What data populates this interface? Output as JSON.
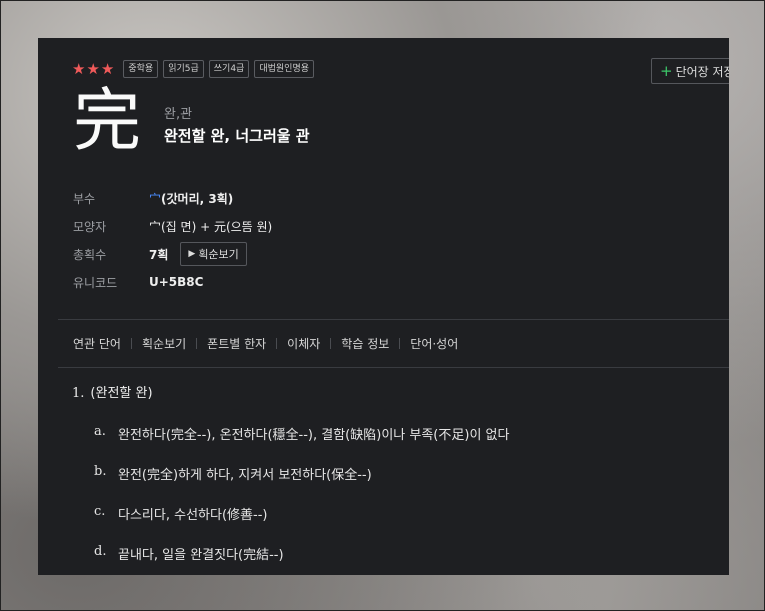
{
  "entry": {
    "stars": "★★★",
    "badges": [
      "중학용",
      "읽기5급",
      "쓰기4급",
      "대법원인명용"
    ],
    "save_button": "단어장 저장",
    "character": "完",
    "reading": "완,관",
    "meaning": "완전할 완, 너그러울 관"
  },
  "info": {
    "radical_label": "부수",
    "radical_glyph": "宀",
    "radical_value": "(갓머리, 3획)",
    "shape_label": "모양자",
    "shape_value": "宀(집 면) + 元(으뜸 원)",
    "strokes_label": "총획수",
    "strokes_value": "7획",
    "stroke_order_button": "획순보기",
    "unicode_label": "유니코드",
    "unicode_value": "U+5B8C"
  },
  "tabs": [
    "연관 단어",
    "획순보기",
    "폰트별 한자",
    "이체자",
    "학습 정보",
    "단어·성어"
  ],
  "definitions": {
    "number": "1.",
    "head": "(완전할 완)",
    "items": [
      {
        "letter": "a.",
        "text": "완전하다(完全--), 온전하다(穩全--), 결함(缺陷)이나 부족(不足)이 없다"
      },
      {
        "letter": "b.",
        "text": "완전(完全)하게 하다, 지켜서 보전하다(保全--)"
      },
      {
        "letter": "c.",
        "text": "다스리다, 수선하다(修善--)"
      },
      {
        "letter": "d.",
        "text": "끝내다, 일을 완결짓다(完結--)"
      }
    ]
  }
}
